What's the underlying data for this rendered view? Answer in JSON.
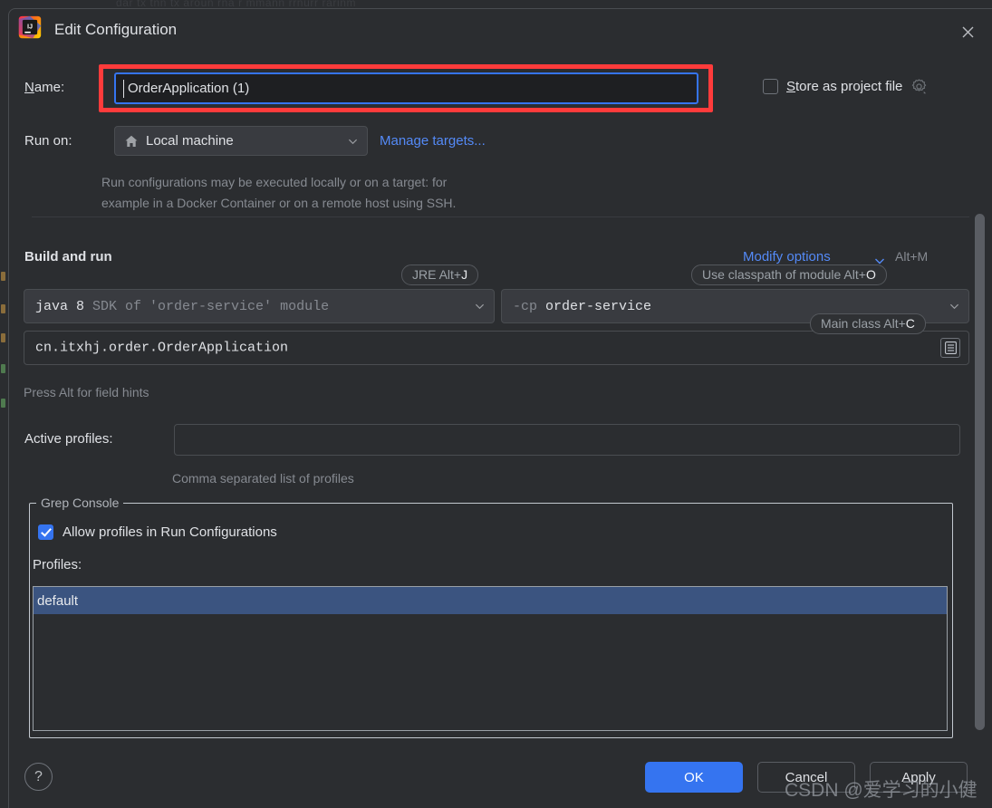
{
  "window": {
    "title": "Edit Configuration",
    "logo_icon": "intellij-idea-logo",
    "close_icon": "close-icon"
  },
  "background": {
    "ghost_text_top": "dar tx tnn tx aroun  rna r mmann rrnurr rarinm"
  },
  "name_row": {
    "label": "Name:",
    "label_mnemonic": "N",
    "value": "OrderApplication (1)",
    "highlight_color": "#ff3b3b",
    "focus_color": "#3574f0"
  },
  "store_as_project_file": {
    "label": "Store as project file",
    "mnemonic": "S",
    "checked": false,
    "gear_icon": "gear-icon"
  },
  "run_on": {
    "label": "Run on:",
    "value": "Local machine",
    "value_icon": "home-icon",
    "chevron_icon": "chevron-down-icon",
    "manage_targets_link": "Manage targets...",
    "hint_line1": "Run configurations may be executed locally or on a target: for",
    "hint_line2": "example in a Docker Container or on a remote host using SSH."
  },
  "build_and_run": {
    "section_title": "Build and run",
    "modify_options_link": "Modify options",
    "modify_options_shortcut": "Alt+M",
    "modify_options_chevron": "chevron-down-icon",
    "jre": {
      "value_bold": "java 8",
      "value_dim": "SDK of 'order-service' module",
      "tooltip": "JRE Alt+",
      "tooltip_key": "J",
      "chevron_icon": "chevron-down-icon"
    },
    "classpath": {
      "prefix": "-cp",
      "value": "order-service",
      "tooltip": "Use classpath of module Alt+",
      "tooltip_key": "O",
      "chevron_icon": "chevron-down-icon"
    },
    "main_class": {
      "value": "cn.itxhj.order.OrderApplication",
      "tooltip": "Main class Alt+",
      "tooltip_key": "C",
      "browse_icon": "list-browse-icon"
    },
    "field_hint": "Press Alt for field hints"
  },
  "active_profiles": {
    "label": "Active profiles:",
    "value": "",
    "hint": "Comma separated list of profiles"
  },
  "grep_console": {
    "group_title": "Grep Console",
    "allow_profiles": {
      "label": "Allow profiles in Run Configurations",
      "checked": true
    },
    "profiles_label": "Profiles:",
    "profiles": [
      "default"
    ],
    "selected_profile": "default"
  },
  "footer": {
    "help_icon": "?",
    "ok": "OK",
    "cancel": "Cancel",
    "apply": "Apply"
  },
  "watermark": {
    "text": "CSDN @爱学习的小健"
  },
  "colors": {
    "dialog_bg": "#2b2d30",
    "field_bg": "#393b40",
    "accent_blue": "#3574f0",
    "link_blue": "#548af7",
    "selection_blue": "#3b5480",
    "annotation_red": "#ff3b3b",
    "text_primary": "#dfe1e5",
    "text_dim": "#868a91"
  }
}
